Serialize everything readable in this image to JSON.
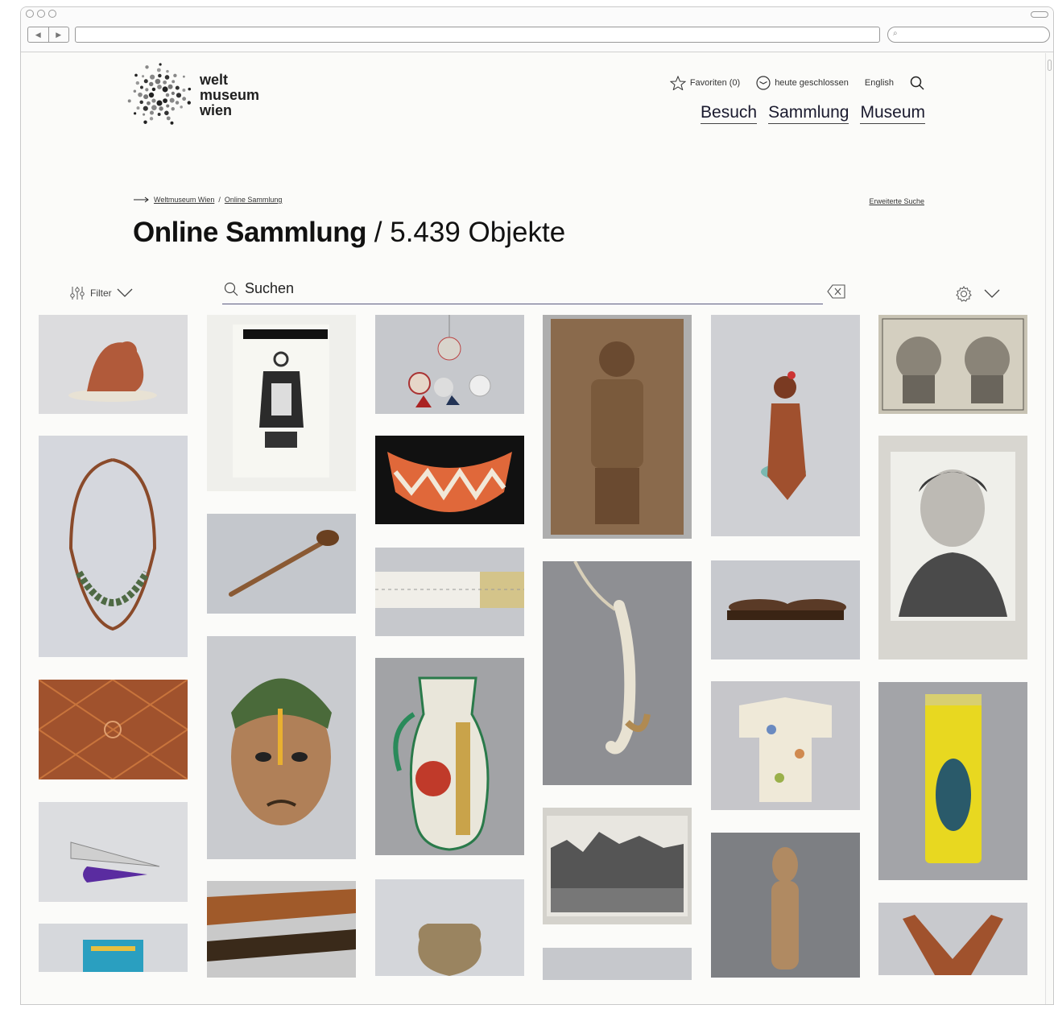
{
  "logo": {
    "line1": "welt",
    "line2": "museum",
    "line3": "wien"
  },
  "utility": {
    "favorites": "Favoriten (0)",
    "status": "heute geschlossen",
    "language": "English"
  },
  "nav": {
    "visit": "Besuch",
    "collection": "Sammlung",
    "museum": "Museum"
  },
  "breadcrumb": {
    "home": "Weltmuseum Wien",
    "separator": "/",
    "current": "Online Sammlung"
  },
  "advanced_search": "Erweiterte Suche",
  "heading": {
    "title": "Online Sammlung",
    "separator": " / ",
    "count": "5.439 Objekte"
  },
  "filter": {
    "label": "Filter"
  },
  "search": {
    "value": "Suchen"
  },
  "gallery_items": [
    "figure-terracotta",
    "necklace",
    "textile-pattern",
    "tweezers-tool",
    "beaded-item",
    "lantern-photo",
    "pipe",
    "turban-head",
    "woven-cloth",
    "pendants",
    "feather-collar",
    "scroll",
    "painted-jug",
    "ceramic-pot",
    "bronze-plaque",
    "bone-hook",
    "city-photo",
    "grey-item",
    "kneeling-figure",
    "wooden-tray",
    "kimono",
    "clay-figure",
    "engraving-portraits",
    "woman-portrait",
    "candle-jar",
    "wooden-fork"
  ]
}
